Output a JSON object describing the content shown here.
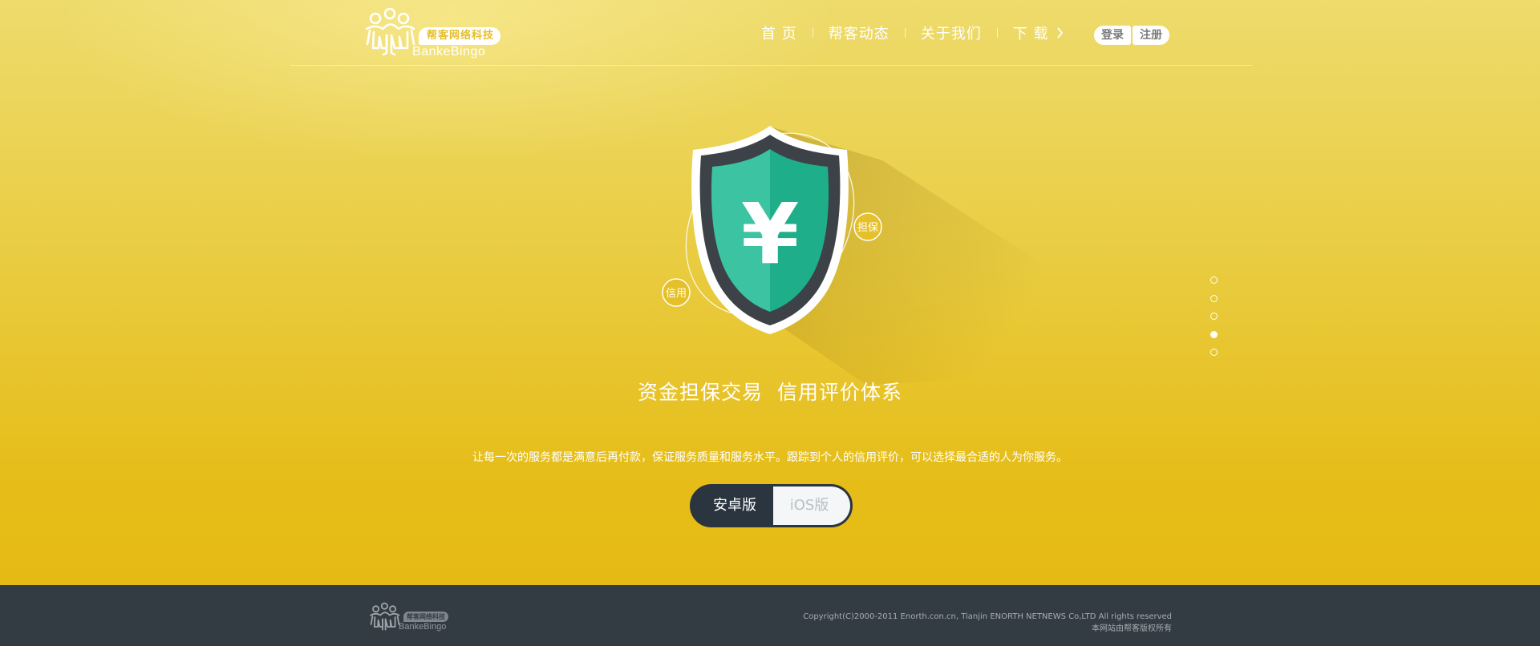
{
  "header": {
    "logo": {
      "badge": "帮客网络科技",
      "wordmark": "BankeBingo"
    },
    "nav": [
      {
        "label": "首 页"
      },
      {
        "label": "帮客动态"
      },
      {
        "label": "关于我们"
      },
      {
        "label": "下 载",
        "icon": "chevron-right-icon"
      }
    ],
    "auth": {
      "login": "登录",
      "register": "注册"
    }
  },
  "hero": {
    "tags": {
      "left": "信用",
      "right": "担保"
    },
    "shield_symbol": "¥",
    "title": "资金担保交易  信用评价体系",
    "description": "让每一次的服务都是满意后再付款，保证服务质量和服务水平。跟踪到个人的信用评价，可以选择最合适的人为你服务。",
    "downloads": {
      "android": "安卓版",
      "ios": "iOS版"
    }
  },
  "pager": {
    "count": 5,
    "active_index": 3
  },
  "footer": {
    "logo": {
      "badge": "帮客网络科技",
      "wordmark": "BankeBingo"
    },
    "copyright_line1": "Copyright(C)2000-2011 Enorth.con.cn, Tianjin ENORTH NETNEWS Co,LTD All rights reserved",
    "copyright_line2": "本网站由帮客版权所有"
  },
  "colors": {
    "background_top": "#eedb6c",
    "background_bottom": "#e5b812",
    "footer": "#333b43",
    "shield_green": "#2bbf98",
    "shield_dark": "#3c4248",
    "toggle_dark": "#2a3540"
  }
}
